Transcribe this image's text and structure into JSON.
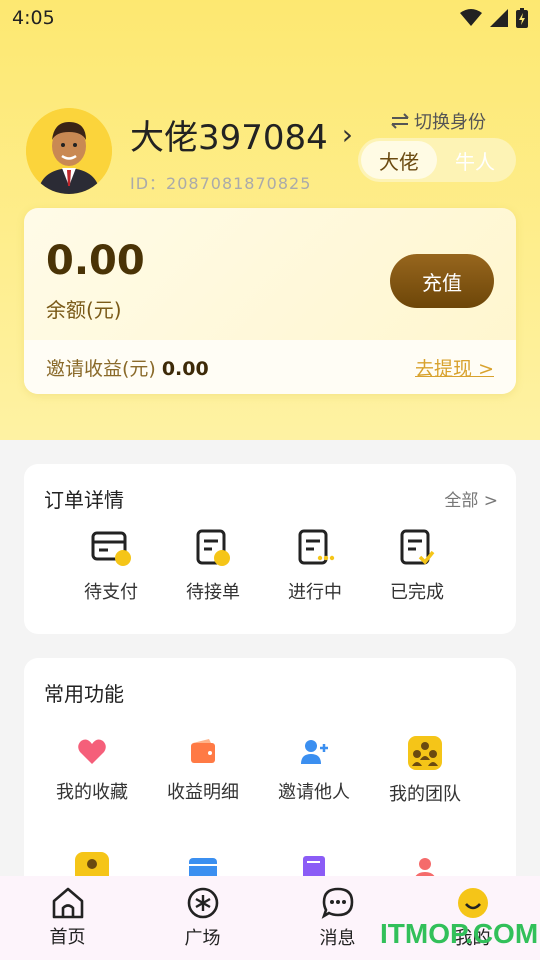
{
  "status_bar": {
    "time": "4:05"
  },
  "profile": {
    "username": "大佬397084",
    "user_id": "ID：2087081870825",
    "switch_label": "切换身份",
    "roles": [
      "大佬",
      "牛人"
    ]
  },
  "balance": {
    "amount": "0.00",
    "label": "余额(元)",
    "recharge_label": "充值",
    "invite_label": "邀请收益(元)",
    "invite_value": "0.00",
    "withdraw_label": "去提现 >"
  },
  "orders": {
    "title": "订单详情",
    "more_label": "全部 >",
    "items": [
      {
        "label": "待支付",
        "icon": "wallet-pending-icon"
      },
      {
        "label": "待接单",
        "icon": "doc-pending-icon"
      },
      {
        "label": "进行中",
        "icon": "doc-inprogress-icon"
      },
      {
        "label": "已完成",
        "icon": "doc-done-icon"
      }
    ]
  },
  "features": {
    "title": "常用功能",
    "items": [
      {
        "label": "我的收藏",
        "icon": "heart-icon"
      },
      {
        "label": "收益明细",
        "icon": "wallet-icon"
      },
      {
        "label": "邀请他人",
        "icon": "add-user-icon"
      },
      {
        "label": "我的团队",
        "icon": "team-icon"
      }
    ]
  },
  "tabbar": {
    "items": [
      {
        "label": "首页",
        "icon": "home-icon"
      },
      {
        "label": "广场",
        "icon": "plaza-icon"
      },
      {
        "label": "消息",
        "icon": "message-icon"
      },
      {
        "label": "我的",
        "icon": "smile-icon"
      }
    ]
  },
  "watermark": "ITMOP.COM",
  "colors": {
    "accent_yellow": "#fde871",
    "brown": "#6d4608",
    "icon_yellow": "#f5c518"
  }
}
